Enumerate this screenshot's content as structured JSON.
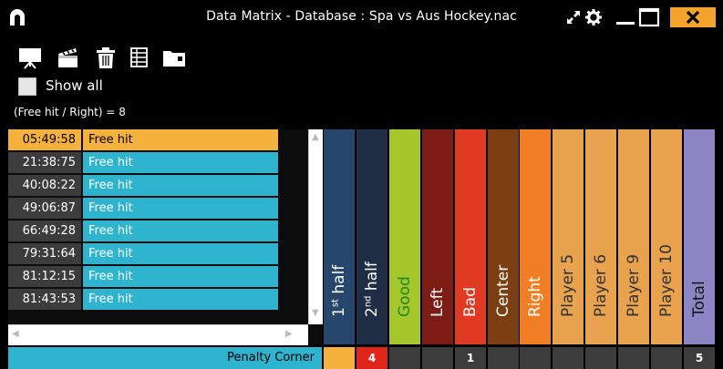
{
  "window": {
    "title": "Data Matrix - Database : Spa vs Aus Hockey.nac"
  },
  "toolbar": {
    "tools": [
      "present-icon",
      "clapperboard-icon",
      "trash-icon",
      "table-icon",
      "folder-icon"
    ]
  },
  "show_all": {
    "label": "Show all",
    "checked": false
  },
  "summary": "(Free hit / Right) = 8",
  "list": {
    "rows": [
      {
        "time": "05:49:58",
        "label": "Free hit",
        "selected": true
      },
      {
        "time": "21:38:75",
        "label": "Free hit",
        "selected": false
      },
      {
        "time": "40:08:22",
        "label": "Free hit",
        "selected": false
      },
      {
        "time": "49:06:87",
        "label": "Free hit",
        "selected": false
      },
      {
        "time": "66:49:28",
        "label": "Free hit",
        "selected": false
      },
      {
        "time": "79:31:64",
        "label": "Free hit",
        "selected": false
      },
      {
        "time": "81:12:15",
        "label": "Free hit",
        "selected": false
      },
      {
        "time": "81:43:53",
        "label": "Free hit",
        "selected": false
      }
    ]
  },
  "columns": [
    {
      "label_main": "1",
      "label_sup": "st",
      "label_rest": " half",
      "color": "#27466b",
      "text_color": "#ffffff"
    },
    {
      "label_main": "2",
      "label_sup": "nd",
      "label_rest": " half",
      "color": "#1f2d45",
      "text_color": "#ffffff"
    },
    {
      "label_main": "Good",
      "label_sup": "",
      "label_rest": "",
      "color": "#a6c72c",
      "text_color": "#1d8a1d"
    },
    {
      "label_main": "Left",
      "label_sup": "",
      "label_rest": "",
      "color": "#7d1b15",
      "text_color": "#ffffff"
    },
    {
      "label_main": "Bad",
      "label_sup": "",
      "label_rest": "",
      "color": "#e03a22",
      "text_color": "#ffffff"
    },
    {
      "label_main": "Center",
      "label_sup": "",
      "label_rest": "",
      "color": "#7c3f12",
      "text_color": "#ffffff"
    },
    {
      "label_main": "Right",
      "label_sup": "",
      "label_rest": "",
      "color": "#ef7f22",
      "text_color": "#ffffff"
    },
    {
      "label_main": "Player 5",
      "label_sup": "",
      "label_rest": "",
      "color": "#e9a24e",
      "text_color": "#333333"
    },
    {
      "label_main": "Player 6",
      "label_sup": "",
      "label_rest": "",
      "color": "#e9a24e",
      "text_color": "#333333"
    },
    {
      "label_main": "Player 9",
      "label_sup": "",
      "label_rest": "",
      "color": "#e9a24e",
      "text_color": "#333333"
    },
    {
      "label_main": "Player 10",
      "label_sup": "",
      "label_rest": "",
      "color": "#e9a24e",
      "text_color": "#333333"
    },
    {
      "label_main": "Total",
      "label_sup": "",
      "label_rest": "",
      "color": "#8b86c3",
      "text_color": "#111111"
    }
  ],
  "bottom": {
    "row_name": "Penalty Corner",
    "cells": [
      {
        "value": "",
        "bg": "#f4b23c"
      },
      {
        "value": "4",
        "bg": "#e0261b"
      },
      {
        "value": "",
        "bg": "#3c3c3c"
      },
      {
        "value": "",
        "bg": "#3c3c3c"
      },
      {
        "value": "1",
        "bg": "#3c3c3c"
      },
      {
        "value": "",
        "bg": "#3c3c3c"
      },
      {
        "value": "",
        "bg": "#3c3c3c"
      },
      {
        "value": "",
        "bg": "#3c3c3c"
      },
      {
        "value": "",
        "bg": "#3c3c3c"
      },
      {
        "value": "",
        "bg": "#3c3c3c"
      },
      {
        "value": "",
        "bg": "#3c3c3c"
      },
      {
        "value": "5",
        "bg": "#3c3c3c"
      }
    ]
  }
}
